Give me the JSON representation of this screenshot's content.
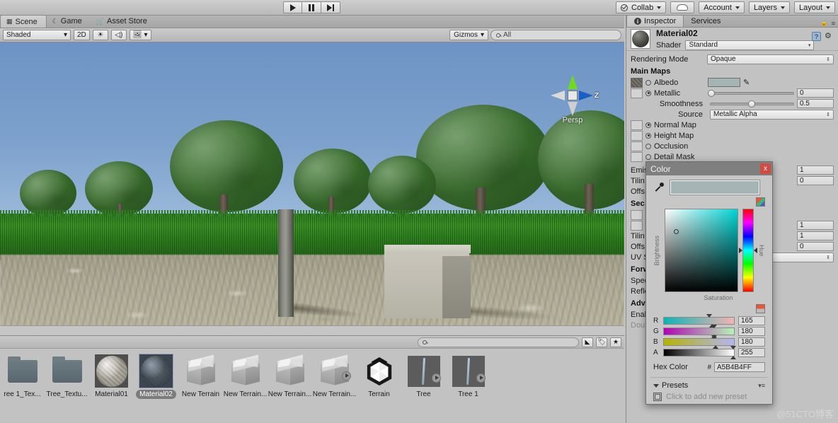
{
  "toolbar": {
    "play_label": "play-icon",
    "pause_label": "pause-icon",
    "step_label": "step-icon",
    "collab": "Collab",
    "cloud": "cloud-icon",
    "account": "Account",
    "layers": "Layers",
    "layout": "Layout"
  },
  "scene": {
    "tabs": [
      {
        "label": "Scene",
        "icon": "grid-icon",
        "active": true
      },
      {
        "label": "Game",
        "icon": "gamepad-icon",
        "active": false
      },
      {
        "label": "Asset Store",
        "icon": "store-icon",
        "active": false
      }
    ],
    "draw_mode": "Shaded",
    "mode_2d": "2D",
    "lighting_icon": "sun-icon",
    "audio_icon": "speaker-icon",
    "fx_icon": "image-icon",
    "gizmos": "Gizmos",
    "search_placeholder": "All",
    "gizmo_nav": {
      "persp": "Persp",
      "axis": "Z"
    }
  },
  "project": {
    "search_placeholder": "",
    "filter_icons": [
      "asset-filter-icon",
      "label-filter-icon",
      "favorite-filter-icon"
    ],
    "assets": [
      {
        "name": "ree 1_Tex...",
        "type": "folder",
        "selected": false
      },
      {
        "name": "Tree_Textu...",
        "type": "folder",
        "selected": false
      },
      {
        "name": "Material01",
        "type": "material-light",
        "selected": false
      },
      {
        "name": "Material02",
        "type": "material-dark",
        "selected": true
      },
      {
        "name": "New Terrain",
        "type": "prefab",
        "selected": false
      },
      {
        "name": "New Terrain...",
        "type": "prefab",
        "selected": false
      },
      {
        "name": "New Terrain...",
        "type": "prefab",
        "selected": false
      },
      {
        "name": "New Terrain...",
        "type": "prefab-arrow",
        "selected": false
      },
      {
        "name": "Terrain",
        "type": "unity",
        "selected": false
      },
      {
        "name": "Tree",
        "type": "tree",
        "selected": false
      },
      {
        "name": "Tree 1",
        "type": "tree",
        "selected": false
      }
    ]
  },
  "inspector": {
    "tabs": [
      {
        "label": "Inspector",
        "active": true
      },
      {
        "label": "Services",
        "active": false
      }
    ],
    "lock_icon": "lock-icon",
    "menu_icon": "menu-icon",
    "material_name": "Material02",
    "help_icon": "help-icon",
    "gear_icon": "gear-icon",
    "shader_label": "Shader",
    "shader_value": "Standard",
    "rendering_mode_label": "Rendering Mode",
    "rendering_mode_value": "Opaque",
    "main_maps_title": "Main Maps",
    "albedo_label": "Albedo",
    "metallic_label": "Metallic",
    "metallic_value": "0",
    "smoothness_label": "Smoothness",
    "smoothness_value": "0.5",
    "source_label": "Source",
    "source_value": "Metallic Alpha",
    "normal_map_label": "Normal Map",
    "height_map_label": "Height Map",
    "occlusion_label": "Occlusion",
    "detail_mask_label": "Detail Mask",
    "emission_label": "Emis",
    "tiling_label": "Tilin",
    "offset_label": "Offs",
    "secondary_title": "Sec",
    "uv_set_label": "UV S",
    "forward_title": "Forw",
    "specular_label": "Spec",
    "reflections_label": "Refle",
    "advanced_title": "Adv",
    "enable_label": "Enab",
    "double_label": "Dou",
    "tiling_x": "1",
    "offset_y": "0",
    "sec_scale": "1",
    "sec_tiling": "1",
    "sec_offset": "0"
  },
  "color_dialog": {
    "title": "Color",
    "close_label": "x",
    "eyedropper": "eyedropper-icon",
    "swatch_hex": "#A5B4B4",
    "brightness_label": "Brightness",
    "saturation_label": "Saturation",
    "hue_label": "Hue",
    "channels": [
      {
        "label": "R",
        "value": "165"
      },
      {
        "label": "G",
        "value": "180"
      },
      {
        "label": "B",
        "value": "180"
      },
      {
        "label": "A",
        "value": "255"
      }
    ],
    "hex_label": "Hex Color",
    "hex_sign": "#",
    "hex_value": "A5B4B4FF",
    "presets_label": "Presets",
    "add_preset_label": "Click to add new preset"
  },
  "watermark": "@51CTO博客"
}
